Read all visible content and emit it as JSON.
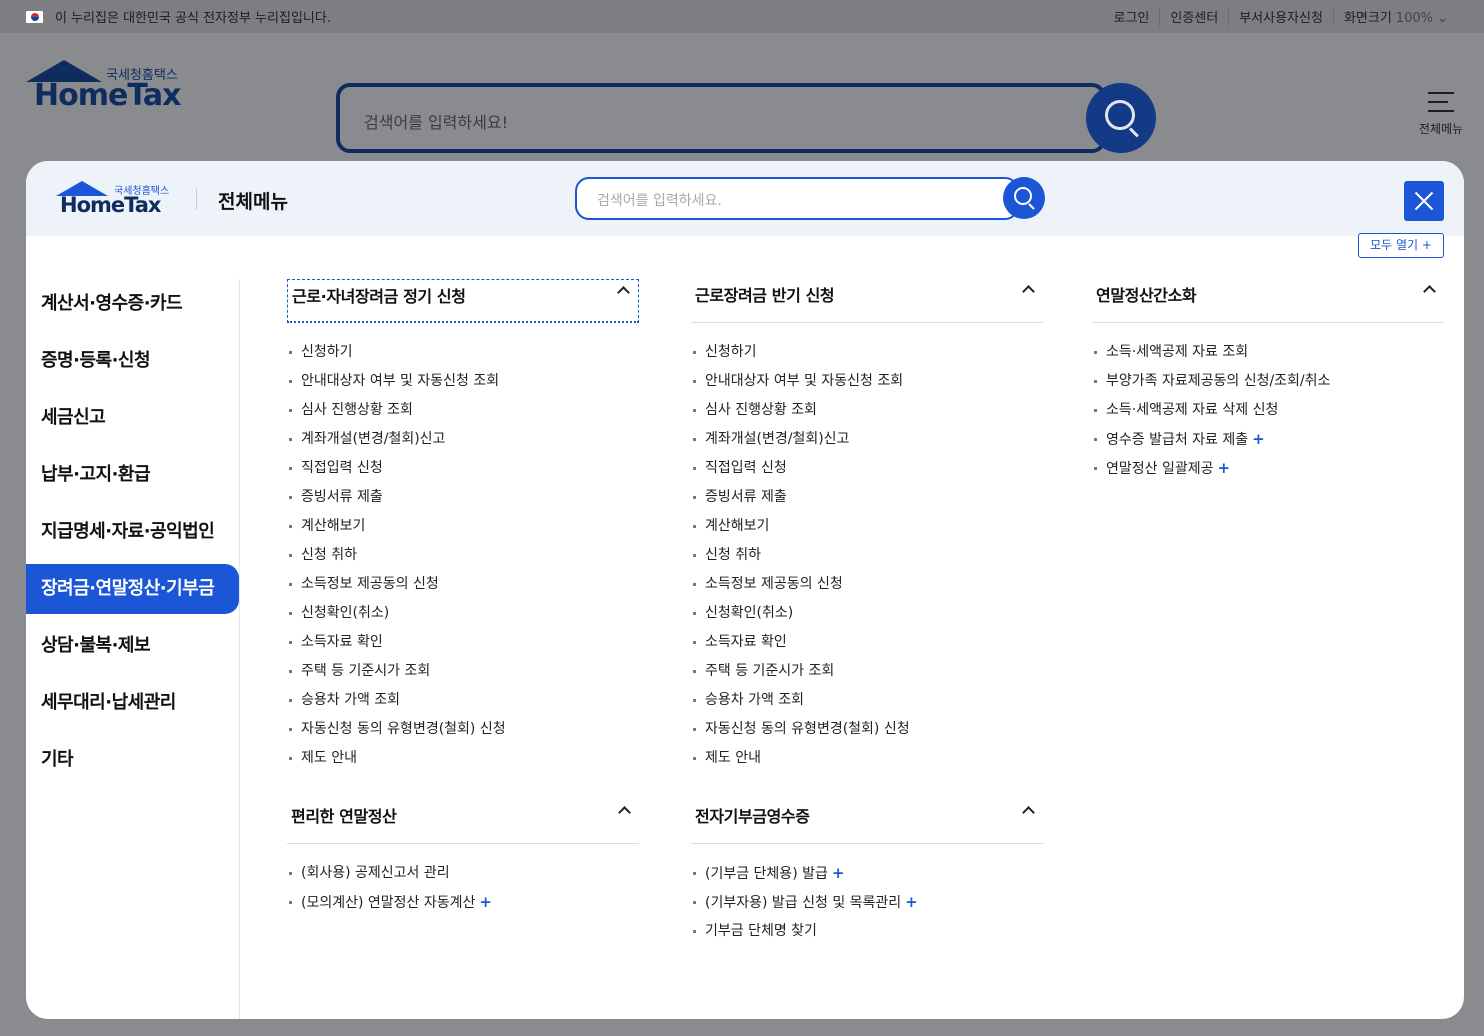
{
  "gov_bar": {
    "text": "이 누리집은 대한민국 공식 전자정부 누리집입니다.",
    "links": [
      "로그인",
      "인증센터",
      "부서사용자신청",
      "화면크기"
    ],
    "zoom": "100% ⌄"
  },
  "background": {
    "logo_kr": "국세청홈택스",
    "logo_en": "HomeTax",
    "search_placeholder": "검색어를 입력하세요!",
    "menu_label": "전체메뉴"
  },
  "modal": {
    "logo_kr": "국세청홈택스",
    "logo_en": "HomeTax",
    "title": "전체메뉴",
    "search_placeholder": "검색어를 입력하세요.",
    "open_all": "모두 열기 +",
    "nav": [
      "계산서·영수증·카드",
      "증명·등록·신청",
      "세금신고",
      "납부·고지·환급",
      "지급명세·자료·공익법인",
      "장려금·연말정산·기부금",
      "상담·불복·제보",
      "세무대리·납세관리",
      "기타"
    ],
    "active_nav": "장려금·연말정산·기부금",
    "sections": [
      {
        "title": "근로·자녀장려금 정기 신청",
        "items": [
          "신청하기",
          "안내대상자 여부 및 자동신청 조회",
          "심사 진행상황 조회",
          "계좌개설(변경/철회)신고",
          "직접입력 신청",
          "증빙서류 제출",
          "계산해보기",
          "신청 취하",
          "소득정보 제공동의 신청",
          "신청확인(취소)",
          "소득자료 확인",
          "주택 등 기준시가 조회",
          "승용차 가액 조회",
          "자동신청 동의 유형변경(철회) 신청",
          "제도 안내"
        ]
      },
      {
        "title": "근로장려금 반기 신청",
        "items": [
          "신청하기",
          "안내대상자 여부 및 자동신청 조회",
          "심사 진행상황 조회",
          "계좌개설(변경/철회)신고",
          "직접입력 신청",
          "증빙서류 제출",
          "계산해보기",
          "신청 취하",
          "소득정보 제공동의 신청",
          "신청확인(취소)",
          "소득자료 확인",
          "주택 등 기준시가 조회",
          "승용차 가액 조회",
          "자동신청 동의 유형변경(철회) 신청",
          "제도 안내"
        ]
      },
      {
        "title": "연말정산간소화",
        "items": [
          "소득·세액공제 자료 조회",
          "부양가족 자료제공동의 신청/조회/취소",
          "소득·세액공제 자료 삭제 신청",
          "영수증 발급처 자료 제출",
          "연말정산 일괄제공"
        ],
        "expandable": [
          false,
          false,
          false,
          true,
          true
        ]
      },
      {
        "title": "편리한 연말정산",
        "items": [
          "(회사용) 공제신고서 관리",
          "(모의계산) 연말정산 자동계산"
        ],
        "expandable": [
          false,
          true
        ]
      },
      {
        "title": "전자기부금영수증",
        "items": [
          "(기부금 단체용) 발급",
          "(기부자용) 발급 신청 및 목록관리",
          "기부금 단체명 찾기"
        ],
        "expandable": [
          true,
          true,
          false
        ]
      }
    ]
  },
  "colors": {
    "accent": "#1a56d6",
    "navy": "#0f2c5f",
    "overlay": "#8a8b8e"
  }
}
